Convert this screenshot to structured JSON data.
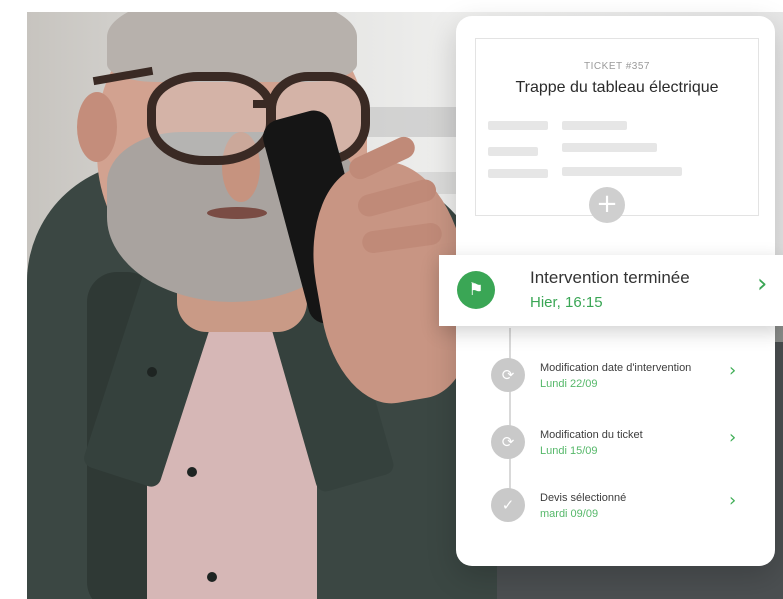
{
  "ticket": {
    "number_label": "TICKET #357",
    "title": "Trappe du tableau électrique",
    "add_icon": "plus-icon",
    "add_glyph": "+"
  },
  "highlight": {
    "title": "Intervention terminée",
    "date": "Hier, 16:15",
    "icon": "checkered-flag-icon",
    "icon_glyph": "⚑",
    "chevron": "›"
  },
  "timeline": [
    {
      "title": "Modification date d'intervention",
      "date": "Lundi 22/09",
      "icon": "sync-icon",
      "glyph": "⟳",
      "chevron": "›"
    },
    {
      "title": "Modification du ticket",
      "date": "Lundi 15/09",
      "icon": "sync-icon",
      "glyph": "⟳",
      "chevron": "›"
    },
    {
      "title": "Devis sélectionné",
      "date": "mardi 09/09",
      "icon": "check-icon",
      "glyph": "✓",
      "chevron": "›"
    }
  ],
  "colors": {
    "accent": "#3aa655",
    "date_green": "#56b86a",
    "icon_grey": "#c9c9c9"
  }
}
